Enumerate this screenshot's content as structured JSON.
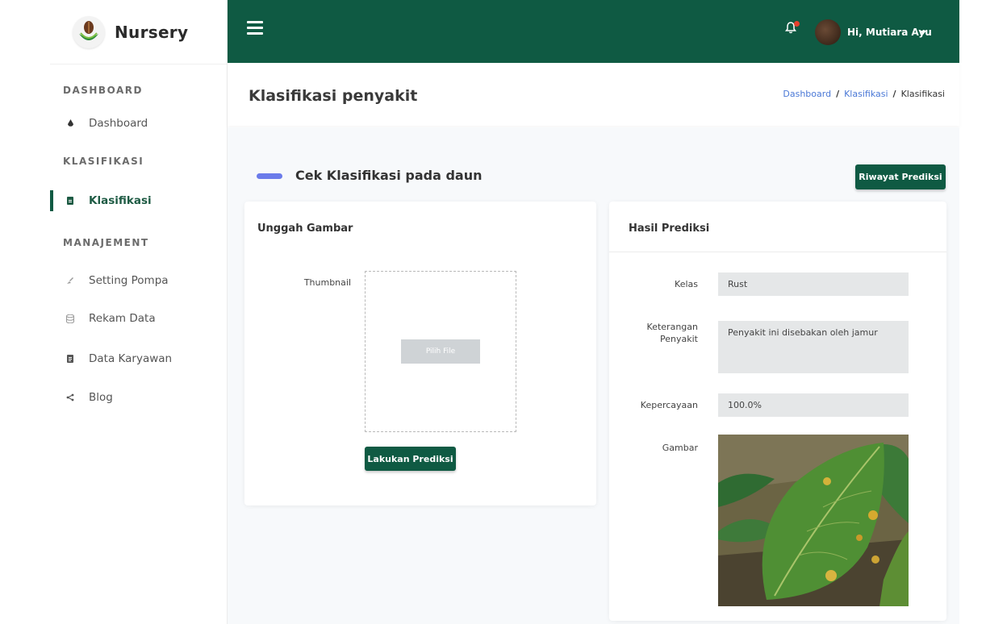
{
  "brand": {
    "name": "Nursery"
  },
  "sidebar": {
    "sections": [
      {
        "title": "DASHBOARD"
      },
      {
        "title": "KLASIFIKASI"
      },
      {
        "title": "MANAJEMENT"
      }
    ],
    "items": [
      {
        "label": "Dashboard",
        "icon": "drop-icon"
      },
      {
        "label": "Klasifikasi",
        "icon": "file-icon",
        "active": true
      },
      {
        "label": "Setting Pompa",
        "icon": "brush-icon"
      },
      {
        "label": "Rekam Data",
        "icon": "database-icon"
      },
      {
        "label": "Data Karyawan",
        "icon": "document-icon"
      },
      {
        "label": "Blog",
        "icon": "share-icon"
      }
    ]
  },
  "topbar": {
    "user_greeting": "Hi, Mutiara Ayu",
    "has_notification": true
  },
  "header": {
    "title": "Klasifikasi penyakit",
    "breadcrumb": [
      "Dashboard",
      "Klasifikasi",
      "Klasifikasi"
    ]
  },
  "main": {
    "section_title": "Cek Klasifikasi pada daun",
    "history_button": "Riwayat Prediksi",
    "upload": {
      "title": "Unggah Gambar",
      "thumbnail_label": "Thumbnail",
      "choose_file": "Pilih File",
      "predict_button": "Lakukan Prediksi"
    },
    "result": {
      "title": "Hasil Prediksi",
      "kelas_label": "Kelas",
      "kelas_value": "Rust",
      "keterangan_label_1": "Keterangan",
      "keterangan_label_2": "Penyakit",
      "keterangan_value": "Penyakit ini disebakan oleh jamur",
      "kepercayaan_label": "Kepercayaan",
      "kepercayaan_value": "100.0%",
      "gambar_label": "Gambar"
    }
  },
  "colors": {
    "primary": "#0f5a43",
    "accent": "#6b7bea",
    "link": "#4a78d6",
    "notification": "#e5412e"
  }
}
